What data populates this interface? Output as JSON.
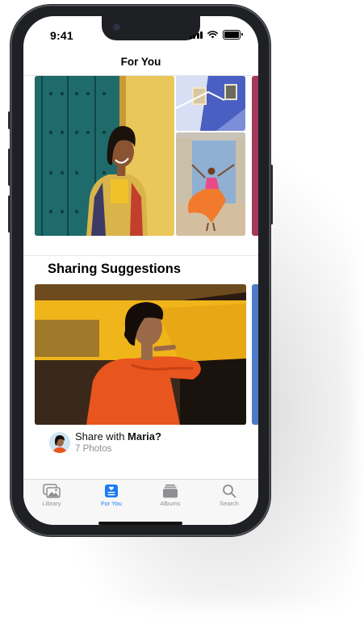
{
  "status": {
    "time": "9:41"
  },
  "header": {
    "title": "For You"
  },
  "sections": {
    "sharing_title": "Sharing Suggestions"
  },
  "share": {
    "prefix": "Share with ",
    "name": "Maria?",
    "count": "7 Photos"
  },
  "tabs": [
    {
      "label": "Library",
      "icon": "photo-library-icon",
      "active": false
    },
    {
      "label": "For You",
      "icon": "for-you-icon",
      "active": true
    },
    {
      "label": "Albums",
      "icon": "albums-icon",
      "active": false
    },
    {
      "label": "Search",
      "icon": "search-icon",
      "active": false
    }
  ],
  "colors": {
    "accent": "#1a7cf5",
    "inactive": "#8e8e93"
  }
}
